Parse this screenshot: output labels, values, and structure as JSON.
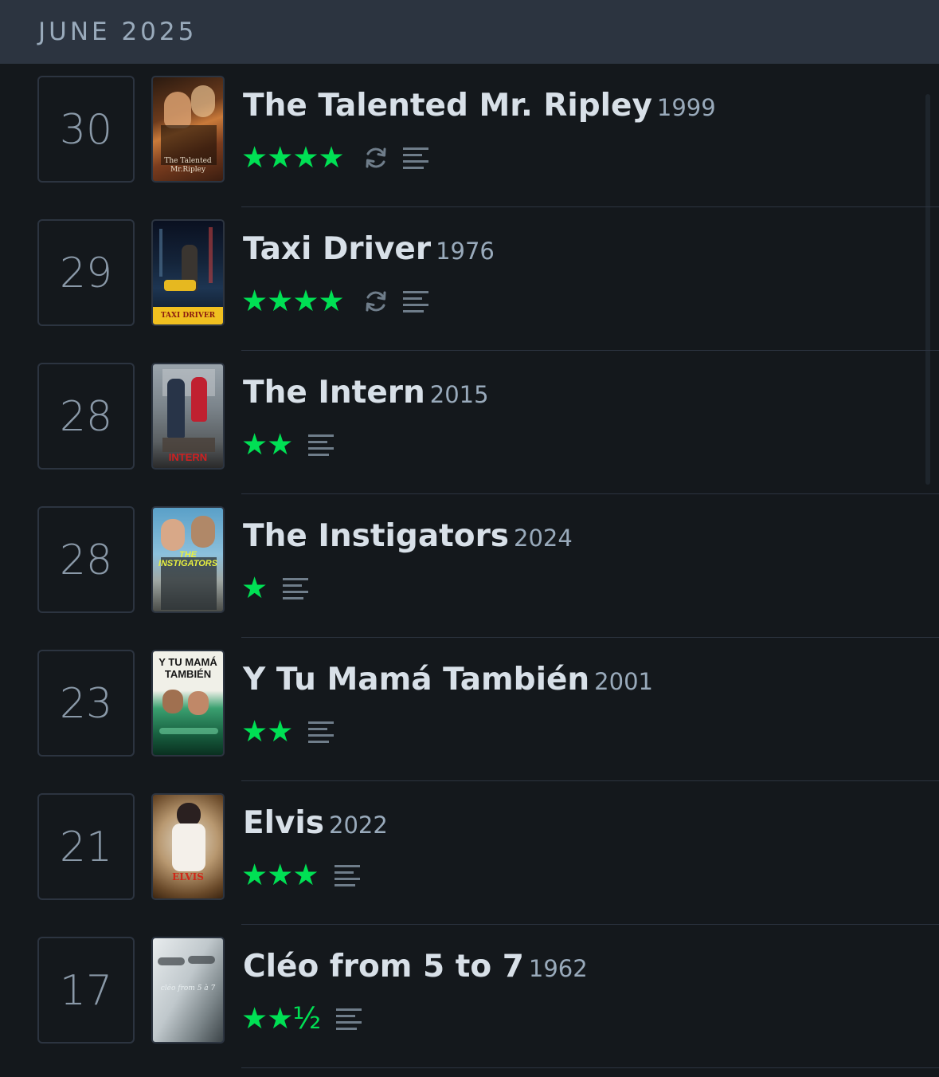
{
  "month": "JUNE 2025",
  "colors": {
    "background": "#14181c",
    "header": "#2c3440",
    "star": "#00e054",
    "title": "#d8e0e8",
    "muted": "#99aabb"
  },
  "entries": [
    {
      "day": "30",
      "title": "The Talented Mr. Ripley",
      "year": "1999",
      "stars": "★★★★",
      "rating": 4,
      "rewatch": true,
      "review": true,
      "poster_text": "The Talented Mr.Ripley"
    },
    {
      "day": "29",
      "title": "Taxi Driver",
      "year": "1976",
      "stars": "★★★★",
      "rating": 4,
      "rewatch": true,
      "review": true,
      "poster_text": "TAXI DRIVER"
    },
    {
      "day": "28",
      "title": "The Intern",
      "year": "2015",
      "stars": "★★",
      "rating": 2,
      "rewatch": false,
      "review": true,
      "poster_text": "INTERN"
    },
    {
      "day": "28",
      "title": "The Instigators",
      "year": "2024",
      "stars": "★",
      "rating": 1,
      "rewatch": false,
      "review": true,
      "poster_text": "THE INSTIGATORS"
    },
    {
      "day": "23",
      "title": "Y Tu Mamá También",
      "year": "2001",
      "stars": "★★",
      "rating": 2,
      "rewatch": false,
      "review": true,
      "poster_text": "Y TU MAMÁ TAMBIÉN"
    },
    {
      "day": "21",
      "title": "Elvis",
      "year": "2022",
      "stars": "★★★",
      "rating": 3,
      "rewatch": false,
      "review": true,
      "poster_text": "ELVIS"
    },
    {
      "day": "17",
      "title": "Cléo from 5 to 7",
      "year": "1962",
      "stars": "★★½",
      "rating": 2.5,
      "rewatch": false,
      "review": true,
      "poster_text": "cléo from 5 à 7"
    }
  ],
  "icons": {
    "rewatch": "rewatch-icon",
    "review": "review-text-icon"
  }
}
